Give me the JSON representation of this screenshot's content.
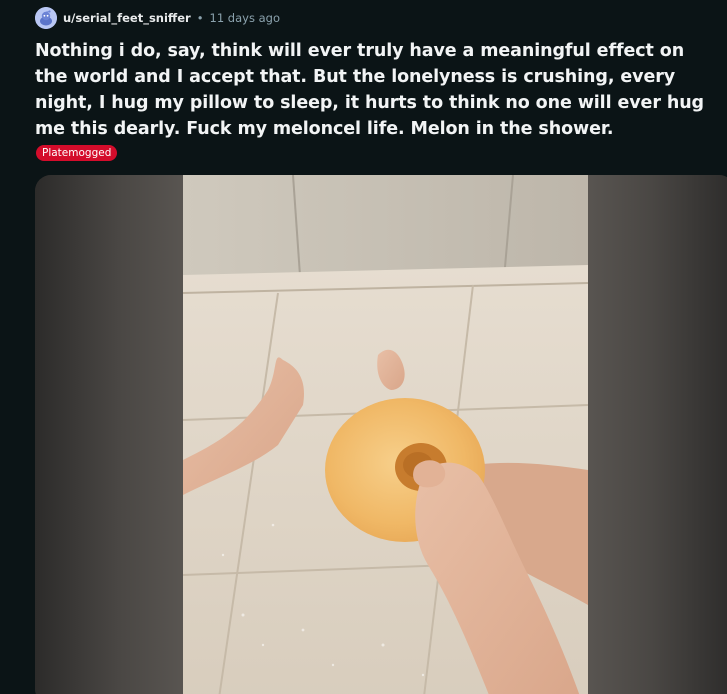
{
  "post": {
    "username": "u/serial_feet_sniffer",
    "separator": "•",
    "time": "11 days ago",
    "title": "Nothing i do, say, think will ever truly have a meaningful effect on the world and I accept that. But the lonelyness is crushing, every night, I hug my pillow to sleep, it hurts to think no one will ever hug me this dearly. Fuck my meloncel life. Melon in the shower.",
    "flair": "Platemogged",
    "avatar_icon": "snoo-avatar-icon",
    "colors": {
      "background": "#0b1416",
      "flair_background": "#d40c2b",
      "meta_text": "#8ba2ad"
    }
  }
}
